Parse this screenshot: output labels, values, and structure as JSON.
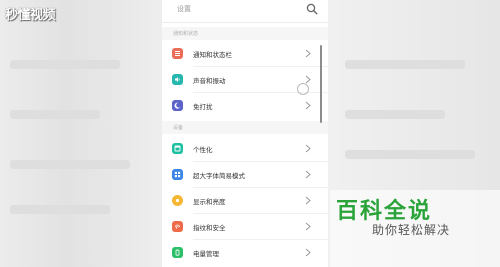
{
  "watermark": {
    "top_left": "秒懂视频",
    "bottom_right_title": "百科全说",
    "bottom_right_sub": "助你轻松解决"
  },
  "search": {
    "placeholder": "设置",
    "icon": "search-icon"
  },
  "sections": [
    {
      "header": "通知和状态",
      "items": [
        {
          "label": "通知和状态栏",
          "icon": "notification-icon",
          "color": "#ea6e57"
        },
        {
          "label": "声音和振动",
          "icon": "sound-icon",
          "color": "#26b7ae"
        },
        {
          "label": "免打扰",
          "icon": "moon-icon",
          "color": "#5c63c9"
        }
      ]
    },
    {
      "header": "设备",
      "items": [
        {
          "label": "个性化",
          "icon": "personalize-icon",
          "color": "#1fbfa1"
        },
        {
          "label": "超大字体简易模式",
          "icon": "grid-icon",
          "color": "#3a86e6"
        },
        {
          "label": "显示和亮度",
          "icon": "brightness-icon",
          "color": "#f5b733"
        },
        {
          "label": "指纹和安全",
          "icon": "fingerprint-icon",
          "color": "#ef6c4a"
        },
        {
          "label": "电量管理",
          "icon": "battery-icon",
          "color": "#2bbf68"
        }
      ]
    }
  ]
}
